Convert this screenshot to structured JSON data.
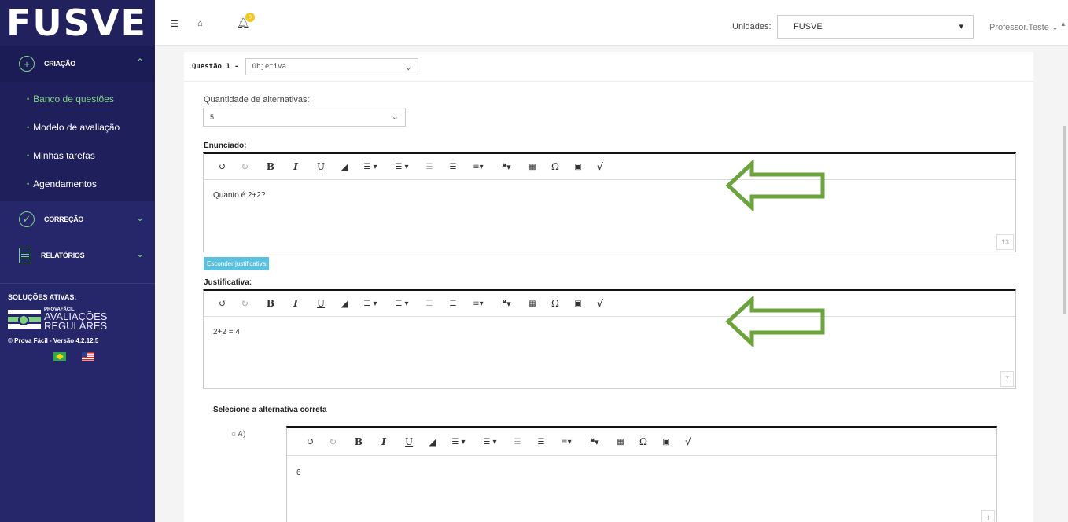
{
  "sidebar": {
    "brand": "FUSVE",
    "menus": [
      {
        "label": "CRIAÇÃO"
      },
      {
        "label": "CORREÇÃO"
      },
      {
        "label": "RELATÓRIOS"
      }
    ],
    "subitems": [
      {
        "label": "Banco de questões"
      },
      {
        "label": "Modelo de avaliação"
      },
      {
        "label": "Minhas tarefas"
      },
      {
        "label": "Agendamentos"
      }
    ],
    "solutions_title": "SOLUÇÕES ATIVAS:",
    "solution_small": "PROVAFÁCIL",
    "solution_line1": "AVALIAÇÕES",
    "solution_line2": "REGULARES",
    "version": "© Prova Fácil - Versão 4.2.12.5"
  },
  "topbar": {
    "notifications_count": "0",
    "units_label": "Unidades:",
    "units_value": "FUSVE",
    "user": "Professor.Teste"
  },
  "question": {
    "title": "Questão 1 -",
    "type": "Objetiva",
    "qty_label": "Quantidade de alternativas:",
    "qty_value": "5",
    "statement_label": "Enunciado:",
    "statement_text": "Quanto é 2+2?",
    "statement_count": "13",
    "hide_button": "Esconder justificativa",
    "justification_label": "Justificativa:",
    "justification_text": "2+2 = 4",
    "justification_count": "7",
    "select_correct": "Selecione a alternativa correta",
    "option_a_label": "A)",
    "option_a_text": "6",
    "option_a_count": "1"
  },
  "colors": {
    "sidebar_bg": "#26266b",
    "accent_green": "#7fd37f",
    "arrow_green": "#6aa43a",
    "button_blue": "#5bc0de"
  }
}
